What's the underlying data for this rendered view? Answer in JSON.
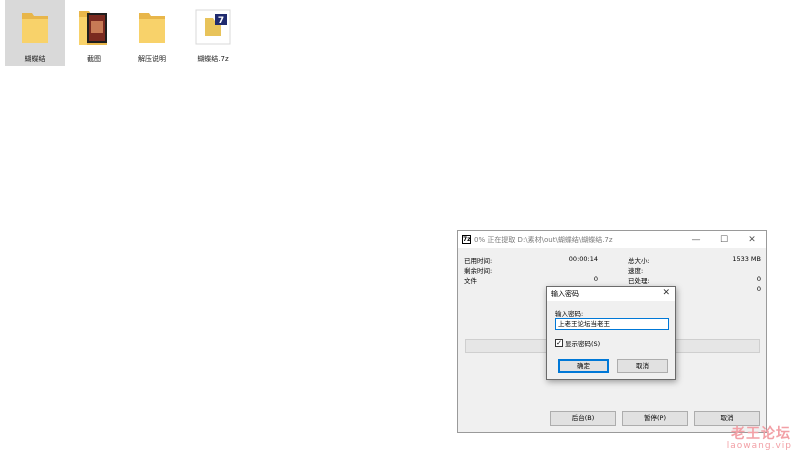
{
  "desktop": {
    "files": [
      {
        "name": "蝴蝶结",
        "type": "folder",
        "selected": true
      },
      {
        "name": "截图",
        "type": "folder-images",
        "selected": false
      },
      {
        "name": "解压说明",
        "type": "folder",
        "selected": false
      },
      {
        "name": "蝴蝶结.7z",
        "type": "7z-archive",
        "selected": false
      }
    ]
  },
  "progress": {
    "title": "0% 正在提取 D:\\素材\\out\\蝴蝶结\\蝴蝶结.7z",
    "app_icon": "7z",
    "minimize": "—",
    "maximize": "☐",
    "close": "✕",
    "left": {
      "elapsed_label": "已用时间:",
      "elapsed_value": "00:00:14",
      "remaining_label": "剩余时间:",
      "files_label": "文件",
      "files_value": "0"
    },
    "right": {
      "total_label": "总大小:",
      "total_value": "1533 MB",
      "speed_label": "速度:",
      "processed_label": "已处理:",
      "processed_value": "0",
      "extra_value": "0"
    },
    "progress_fraction": 0,
    "buttons": {
      "background": "后台(B)",
      "pause": "暂停(P)",
      "cancel": "取消"
    }
  },
  "password_dialog": {
    "title": "输入密码",
    "close": "✕",
    "label": "输入密码:",
    "value": "上老王论坛当老王",
    "show_password_label": "显示密码(S)",
    "show_password_checked": true,
    "checkmark": "✓",
    "ok": "确定",
    "cancel": "取消"
  },
  "watermark": {
    "line1": "老王论坛",
    "line2": "laowang.vip"
  },
  "colors": {
    "folder": "#f8d26a",
    "folder_dark": "#e8b64a",
    "accent": "#0078d7",
    "watermark": "#f2a0a6"
  }
}
